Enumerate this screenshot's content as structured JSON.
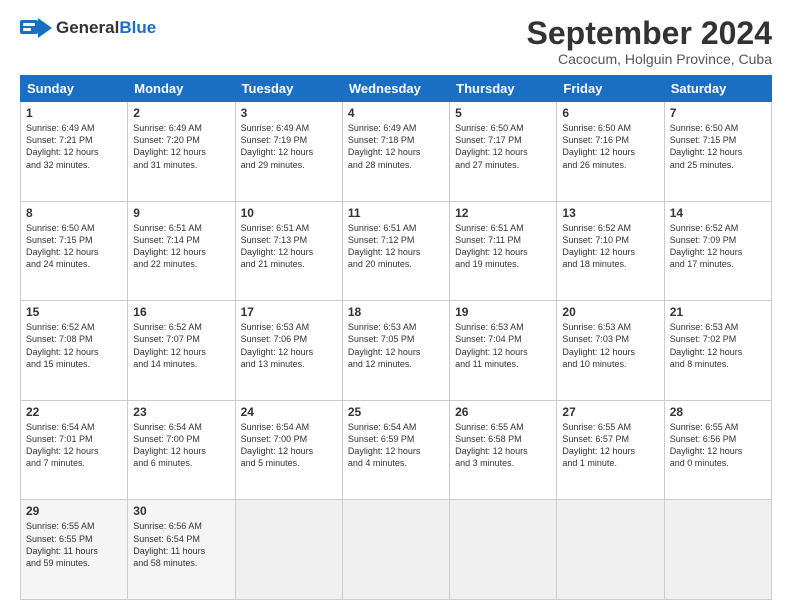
{
  "logo": {
    "general": "General",
    "blue": "Blue"
  },
  "title": "September 2024",
  "subtitle": "Cacocum, Holguin Province, Cuba",
  "headers": [
    "Sunday",
    "Monday",
    "Tuesday",
    "Wednesday",
    "Thursday",
    "Friday",
    "Saturday"
  ],
  "weeks": [
    [
      {
        "day": "1",
        "text": "Sunrise: 6:49 AM\nSunset: 7:21 PM\nDaylight: 12 hours\nand 32 minutes."
      },
      {
        "day": "2",
        "text": "Sunrise: 6:49 AM\nSunset: 7:20 PM\nDaylight: 12 hours\nand 31 minutes."
      },
      {
        "day": "3",
        "text": "Sunrise: 6:49 AM\nSunset: 7:19 PM\nDaylight: 12 hours\nand 29 minutes."
      },
      {
        "day": "4",
        "text": "Sunrise: 6:49 AM\nSunset: 7:18 PM\nDaylight: 12 hours\nand 28 minutes."
      },
      {
        "day": "5",
        "text": "Sunrise: 6:50 AM\nSunset: 7:17 PM\nDaylight: 12 hours\nand 27 minutes."
      },
      {
        "day": "6",
        "text": "Sunrise: 6:50 AM\nSunset: 7:16 PM\nDaylight: 12 hours\nand 26 minutes."
      },
      {
        "day": "7",
        "text": "Sunrise: 6:50 AM\nSunset: 7:15 PM\nDaylight: 12 hours\nand 25 minutes."
      }
    ],
    [
      {
        "day": "8",
        "text": "Sunrise: 6:50 AM\nSunset: 7:15 PM\nDaylight: 12 hours\nand 24 minutes."
      },
      {
        "day": "9",
        "text": "Sunrise: 6:51 AM\nSunset: 7:14 PM\nDaylight: 12 hours\nand 22 minutes."
      },
      {
        "day": "10",
        "text": "Sunrise: 6:51 AM\nSunset: 7:13 PM\nDaylight: 12 hours\nand 21 minutes."
      },
      {
        "day": "11",
        "text": "Sunrise: 6:51 AM\nSunset: 7:12 PM\nDaylight: 12 hours\nand 20 minutes."
      },
      {
        "day": "12",
        "text": "Sunrise: 6:51 AM\nSunset: 7:11 PM\nDaylight: 12 hours\nand 19 minutes."
      },
      {
        "day": "13",
        "text": "Sunrise: 6:52 AM\nSunset: 7:10 PM\nDaylight: 12 hours\nand 18 minutes."
      },
      {
        "day": "14",
        "text": "Sunrise: 6:52 AM\nSunset: 7:09 PM\nDaylight: 12 hours\nand 17 minutes."
      }
    ],
    [
      {
        "day": "15",
        "text": "Sunrise: 6:52 AM\nSunset: 7:08 PM\nDaylight: 12 hours\nand 15 minutes."
      },
      {
        "day": "16",
        "text": "Sunrise: 6:52 AM\nSunset: 7:07 PM\nDaylight: 12 hours\nand 14 minutes."
      },
      {
        "day": "17",
        "text": "Sunrise: 6:53 AM\nSunset: 7:06 PM\nDaylight: 12 hours\nand 13 minutes."
      },
      {
        "day": "18",
        "text": "Sunrise: 6:53 AM\nSunset: 7:05 PM\nDaylight: 12 hours\nand 12 minutes."
      },
      {
        "day": "19",
        "text": "Sunrise: 6:53 AM\nSunset: 7:04 PM\nDaylight: 12 hours\nand 11 minutes."
      },
      {
        "day": "20",
        "text": "Sunrise: 6:53 AM\nSunset: 7:03 PM\nDaylight: 12 hours\nand 10 minutes."
      },
      {
        "day": "21",
        "text": "Sunrise: 6:53 AM\nSunset: 7:02 PM\nDaylight: 12 hours\nand 8 minutes."
      }
    ],
    [
      {
        "day": "22",
        "text": "Sunrise: 6:54 AM\nSunset: 7:01 PM\nDaylight: 12 hours\nand 7 minutes."
      },
      {
        "day": "23",
        "text": "Sunrise: 6:54 AM\nSunset: 7:00 PM\nDaylight: 12 hours\nand 6 minutes."
      },
      {
        "day": "24",
        "text": "Sunrise: 6:54 AM\nSunset: 7:00 PM\nDaylight: 12 hours\nand 5 minutes."
      },
      {
        "day": "25",
        "text": "Sunrise: 6:54 AM\nSunset: 6:59 PM\nDaylight: 12 hours\nand 4 minutes."
      },
      {
        "day": "26",
        "text": "Sunrise: 6:55 AM\nSunset: 6:58 PM\nDaylight: 12 hours\nand 3 minutes."
      },
      {
        "day": "27",
        "text": "Sunrise: 6:55 AM\nSunset: 6:57 PM\nDaylight: 12 hours\nand 1 minute."
      },
      {
        "day": "28",
        "text": "Sunrise: 6:55 AM\nSunset: 6:56 PM\nDaylight: 12 hours\nand 0 minutes."
      }
    ],
    [
      {
        "day": "29",
        "text": "Sunrise: 6:55 AM\nSunset: 6:55 PM\nDaylight: 11 hours\nand 59 minutes."
      },
      {
        "day": "30",
        "text": "Sunrise: 6:56 AM\nSunset: 6:54 PM\nDaylight: 11 hours\nand 58 minutes."
      },
      {
        "day": "",
        "text": ""
      },
      {
        "day": "",
        "text": ""
      },
      {
        "day": "",
        "text": ""
      },
      {
        "day": "",
        "text": ""
      },
      {
        "day": "",
        "text": ""
      }
    ]
  ]
}
